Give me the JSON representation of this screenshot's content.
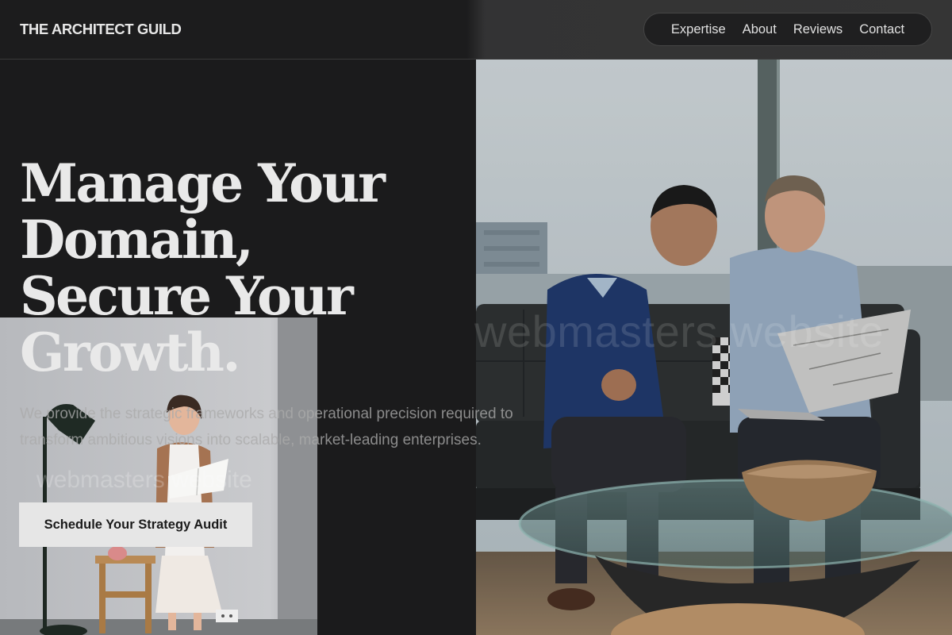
{
  "header": {
    "brand": "THE ARCHITECT GUILD",
    "nav": [
      "Expertise",
      "About",
      "Reviews",
      "Contact"
    ]
  },
  "hero": {
    "title_lines": [
      "Manage Your",
      "Domain,",
      "Secure Your",
      "Growth."
    ],
    "subtitle": "We provide the strategic frameworks and operational precision required to transform ambitious visions into scalable, market-leading enterprises.",
    "cta_label": "Schedule Your Strategy Audit"
  },
  "watermarks": [
    "webmasters website",
    "webmasters website"
  ],
  "images": {
    "right": "office-meeting-photo",
    "left": "woman-with-book-photo"
  },
  "colors": {
    "background": "#1b1b1c",
    "header_right": "#353535",
    "text": "#e9e9e9",
    "cta_bg": "#e6e6e6",
    "cta_text": "#1a1a1a"
  }
}
